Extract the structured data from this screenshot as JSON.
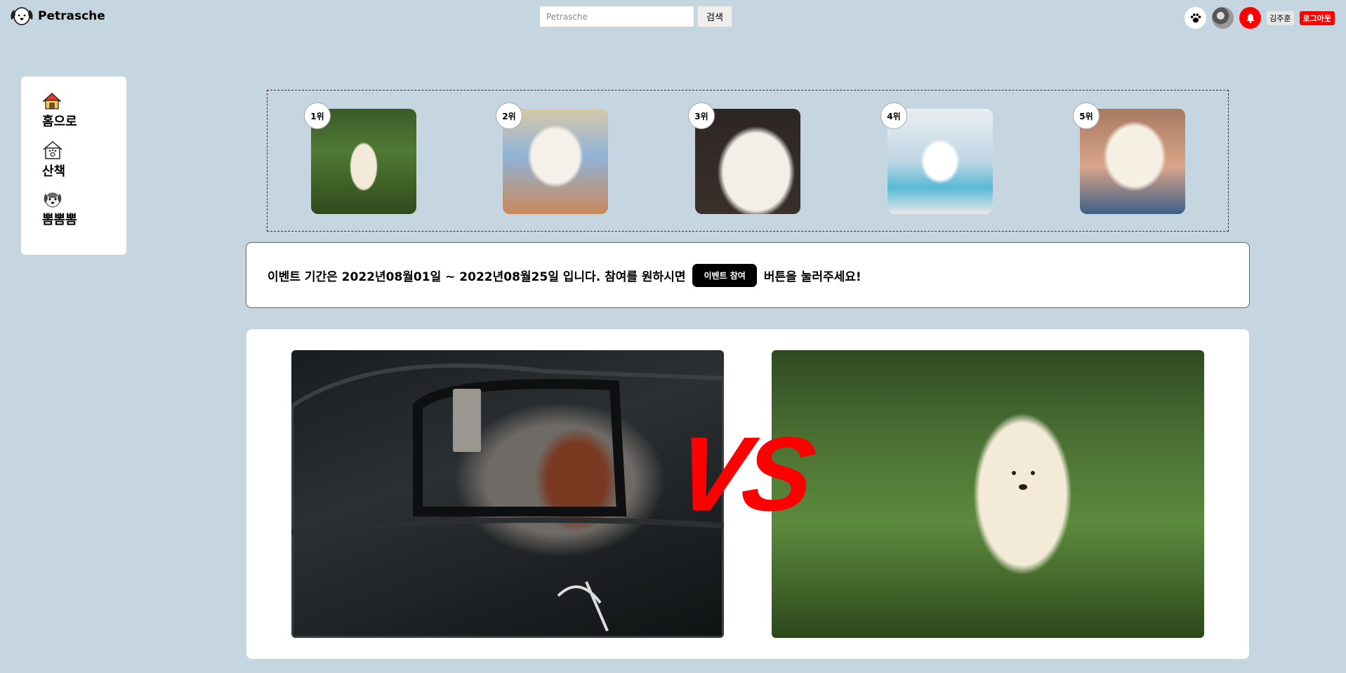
{
  "header": {
    "brand": "Petrasche",
    "search": {
      "placeholder": "Petrasche",
      "button_label": "검색"
    },
    "user_name": "김주훈",
    "logout_label": "로그아웃"
  },
  "sidebar": {
    "items": [
      {
        "label": "홈으로",
        "icon": "house-icon"
      },
      {
        "label": "산책",
        "icon": "dog-house-icon"
      },
      {
        "label": "뽐뽐뽐",
        "icon": "dog-face-icon"
      }
    ]
  },
  "ranking": {
    "items": [
      {
        "rank": "1위"
      },
      {
        "rank": "2위"
      },
      {
        "rank": "3위"
      },
      {
        "rank": "4위"
      },
      {
        "rank": "5위"
      }
    ]
  },
  "event": {
    "text_before": "이벤트 기간은 2022년08월01일 ~ 2022년08월25일 입니다. 참여를 원하시면",
    "button_label": "이벤트 참여",
    "text_after": "버튼을 눌러주세요!"
  },
  "vs": {
    "label": "VS"
  },
  "colors": {
    "background": "#c5d6e0",
    "accent_red": "#ff0000"
  }
}
